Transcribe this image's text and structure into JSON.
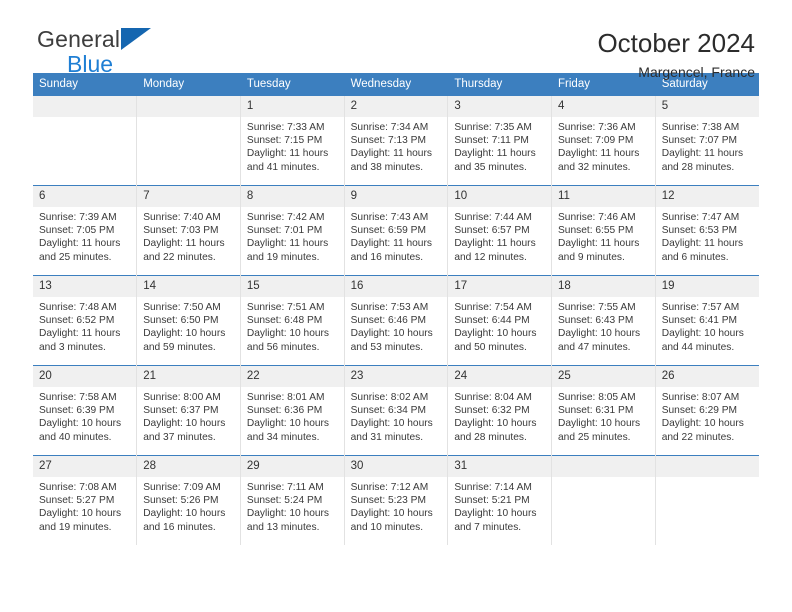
{
  "logo": {
    "word1": "General",
    "word2": "Blue",
    "triangle_color": "#1566b0",
    "word2_color": "#1f7fd4"
  },
  "header": {
    "title": "October 2024",
    "subtitle": "Margencel, France"
  },
  "theme": {
    "header_bg": "#3c7fbf",
    "daynum_bg": "#f0f0f0",
    "text": "#3a3a3a"
  },
  "calendar": {
    "weekday_headers": [
      "Sunday",
      "Monday",
      "Tuesday",
      "Wednesday",
      "Thursday",
      "Friday",
      "Saturday"
    ],
    "labels": {
      "sunrise": "Sunrise:",
      "sunset": "Sunset:",
      "daylight": "Daylight:"
    },
    "weeks": [
      [
        {
          "day": "",
          "empty": true
        },
        {
          "day": "",
          "empty": true
        },
        {
          "day": "1",
          "sunrise": "Sunrise: 7:33 AM",
          "sunset": "Sunset: 7:15 PM",
          "daylight": "Daylight: 11 hours and 41 minutes."
        },
        {
          "day": "2",
          "sunrise": "Sunrise: 7:34 AM",
          "sunset": "Sunset: 7:13 PM",
          "daylight": "Daylight: 11 hours and 38 minutes."
        },
        {
          "day": "3",
          "sunrise": "Sunrise: 7:35 AM",
          "sunset": "Sunset: 7:11 PM",
          "daylight": "Daylight: 11 hours and 35 minutes."
        },
        {
          "day": "4",
          "sunrise": "Sunrise: 7:36 AM",
          "sunset": "Sunset: 7:09 PM",
          "daylight": "Daylight: 11 hours and 32 minutes."
        },
        {
          "day": "5",
          "sunrise": "Sunrise: 7:38 AM",
          "sunset": "Sunset: 7:07 PM",
          "daylight": "Daylight: 11 hours and 28 minutes."
        }
      ],
      [
        {
          "day": "6",
          "sunrise": "Sunrise: 7:39 AM",
          "sunset": "Sunset: 7:05 PM",
          "daylight": "Daylight: 11 hours and 25 minutes."
        },
        {
          "day": "7",
          "sunrise": "Sunrise: 7:40 AM",
          "sunset": "Sunset: 7:03 PM",
          "daylight": "Daylight: 11 hours and 22 minutes."
        },
        {
          "day": "8",
          "sunrise": "Sunrise: 7:42 AM",
          "sunset": "Sunset: 7:01 PM",
          "daylight": "Daylight: 11 hours and 19 minutes."
        },
        {
          "day": "9",
          "sunrise": "Sunrise: 7:43 AM",
          "sunset": "Sunset: 6:59 PM",
          "daylight": "Daylight: 11 hours and 16 minutes."
        },
        {
          "day": "10",
          "sunrise": "Sunrise: 7:44 AM",
          "sunset": "Sunset: 6:57 PM",
          "daylight": "Daylight: 11 hours and 12 minutes."
        },
        {
          "day": "11",
          "sunrise": "Sunrise: 7:46 AM",
          "sunset": "Sunset: 6:55 PM",
          "daylight": "Daylight: 11 hours and 9 minutes."
        },
        {
          "day": "12",
          "sunrise": "Sunrise: 7:47 AM",
          "sunset": "Sunset: 6:53 PM",
          "daylight": "Daylight: 11 hours and 6 minutes."
        }
      ],
      [
        {
          "day": "13",
          "sunrise": "Sunrise: 7:48 AM",
          "sunset": "Sunset: 6:52 PM",
          "daylight": "Daylight: 11 hours and 3 minutes."
        },
        {
          "day": "14",
          "sunrise": "Sunrise: 7:50 AM",
          "sunset": "Sunset: 6:50 PM",
          "daylight": "Daylight: 10 hours and 59 minutes."
        },
        {
          "day": "15",
          "sunrise": "Sunrise: 7:51 AM",
          "sunset": "Sunset: 6:48 PM",
          "daylight": "Daylight: 10 hours and 56 minutes."
        },
        {
          "day": "16",
          "sunrise": "Sunrise: 7:53 AM",
          "sunset": "Sunset: 6:46 PM",
          "daylight": "Daylight: 10 hours and 53 minutes."
        },
        {
          "day": "17",
          "sunrise": "Sunrise: 7:54 AM",
          "sunset": "Sunset: 6:44 PM",
          "daylight": "Daylight: 10 hours and 50 minutes."
        },
        {
          "day": "18",
          "sunrise": "Sunrise: 7:55 AM",
          "sunset": "Sunset: 6:43 PM",
          "daylight": "Daylight: 10 hours and 47 minutes."
        },
        {
          "day": "19",
          "sunrise": "Sunrise: 7:57 AM",
          "sunset": "Sunset: 6:41 PM",
          "daylight": "Daylight: 10 hours and 44 minutes."
        }
      ],
      [
        {
          "day": "20",
          "sunrise": "Sunrise: 7:58 AM",
          "sunset": "Sunset: 6:39 PM",
          "daylight": "Daylight: 10 hours and 40 minutes."
        },
        {
          "day": "21",
          "sunrise": "Sunrise: 8:00 AM",
          "sunset": "Sunset: 6:37 PM",
          "daylight": "Daylight: 10 hours and 37 minutes."
        },
        {
          "day": "22",
          "sunrise": "Sunrise: 8:01 AM",
          "sunset": "Sunset: 6:36 PM",
          "daylight": "Daylight: 10 hours and 34 minutes."
        },
        {
          "day": "23",
          "sunrise": "Sunrise: 8:02 AM",
          "sunset": "Sunset: 6:34 PM",
          "daylight": "Daylight: 10 hours and 31 minutes."
        },
        {
          "day": "24",
          "sunrise": "Sunrise: 8:04 AM",
          "sunset": "Sunset: 6:32 PM",
          "daylight": "Daylight: 10 hours and 28 minutes."
        },
        {
          "day": "25",
          "sunrise": "Sunrise: 8:05 AM",
          "sunset": "Sunset: 6:31 PM",
          "daylight": "Daylight: 10 hours and 25 minutes."
        },
        {
          "day": "26",
          "sunrise": "Sunrise: 8:07 AM",
          "sunset": "Sunset: 6:29 PM",
          "daylight": "Daylight: 10 hours and 22 minutes."
        }
      ],
      [
        {
          "day": "27",
          "sunrise": "Sunrise: 7:08 AM",
          "sunset": "Sunset: 5:27 PM",
          "daylight": "Daylight: 10 hours and 19 minutes."
        },
        {
          "day": "28",
          "sunrise": "Sunrise: 7:09 AM",
          "sunset": "Sunset: 5:26 PM",
          "daylight": "Daylight: 10 hours and 16 minutes."
        },
        {
          "day": "29",
          "sunrise": "Sunrise: 7:11 AM",
          "sunset": "Sunset: 5:24 PM",
          "daylight": "Daylight: 10 hours and 13 minutes."
        },
        {
          "day": "30",
          "sunrise": "Sunrise: 7:12 AM",
          "sunset": "Sunset: 5:23 PM",
          "daylight": "Daylight: 10 hours and 10 minutes."
        },
        {
          "day": "31",
          "sunrise": "Sunrise: 7:14 AM",
          "sunset": "Sunset: 5:21 PM",
          "daylight": "Daylight: 10 hours and 7 minutes."
        },
        {
          "day": "",
          "empty": true
        },
        {
          "day": "",
          "empty": true
        }
      ]
    ]
  }
}
